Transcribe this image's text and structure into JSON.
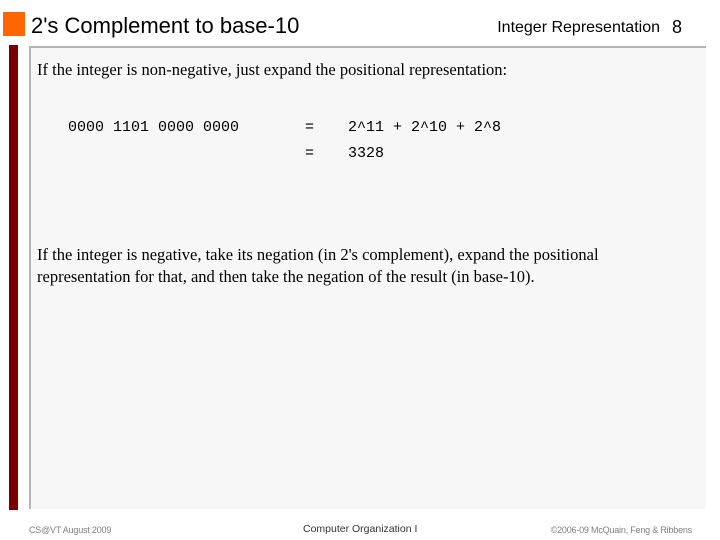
{
  "header": {
    "title": "2's Complement to base-10",
    "topic": "Integer Representation",
    "page_number": "8"
  },
  "body": {
    "paragraph1": "If the integer is non-negative, just expand the positional representation:",
    "example": {
      "binary": "0000 1101 0000 0000",
      "rows": [
        {
          "eq": "=",
          "rhs": "2^11 + 2^10 + 2^8"
        },
        {
          "eq": "=",
          "rhs": "3328"
        }
      ]
    },
    "paragraph2": "If the integer is negative, take its negation (in 2's complement), expand the positional representation for that, and then take the negation of the result (in base-10)."
  },
  "footer": {
    "left": "CS@VT August 2009",
    "center": "Computer Organization I",
    "right": "©2006-09  McQuain, Feng & Ribbens"
  },
  "colors": {
    "accent_orange": "#ff6600",
    "side_bar_red": "#7a0000",
    "content_bg": "#f7f7f7"
  }
}
